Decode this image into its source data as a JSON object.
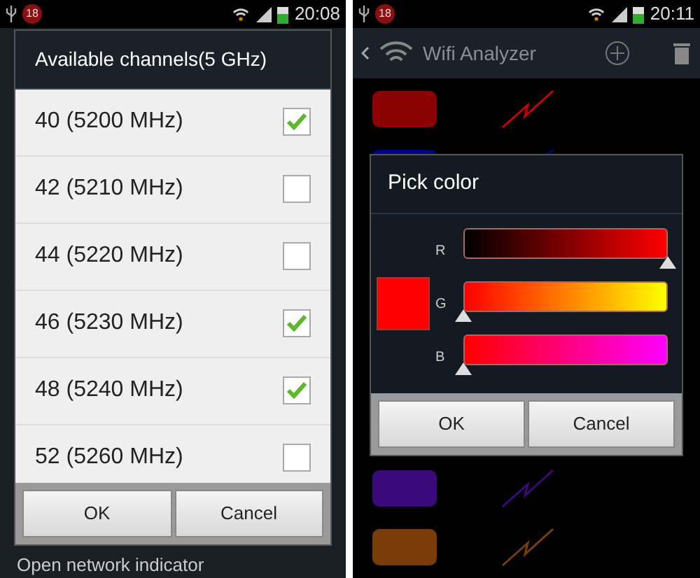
{
  "screens": [
    {
      "status_bar": {
        "badge": "18",
        "time": "20:08"
      },
      "background_text": "Open network indicator",
      "dialog": {
        "title": "Available channels(5 GHz)",
        "items": [
          {
            "label": "40 (5200 MHz)",
            "checked": true
          },
          {
            "label": "42 (5210 MHz)",
            "checked": false
          },
          {
            "label": "44 (5220 MHz)",
            "checked": false
          },
          {
            "label": "46 (5230 MHz)",
            "checked": true
          },
          {
            "label": "48 (5240 MHz)",
            "checked": true
          },
          {
            "label": "52 (5260 MHz)",
            "checked": false
          }
        ],
        "buttons": [
          "OK",
          "Cancel"
        ]
      }
    },
    {
      "status_bar": {
        "badge": "18",
        "time": "20:11"
      },
      "action_bar": {
        "title": "Wifi Analyzer"
      },
      "swatches_top": [
        {
          "color": "#8b0000"
        },
        {
          "color": "#00008b"
        }
      ],
      "swatches_bottom": [
        {
          "color": "#3a0a7a"
        },
        {
          "color": "#7a3d0a"
        }
      ],
      "dialog": {
        "title": "Pick color",
        "sliders": [
          {
            "label": "R",
            "level": 1
          },
          {
            "label": "G",
            "level": 0
          },
          {
            "label": "B",
            "level": 0
          }
        ],
        "buttons": [
          "OK",
          "Cancel"
        ]
      }
    }
  ]
}
